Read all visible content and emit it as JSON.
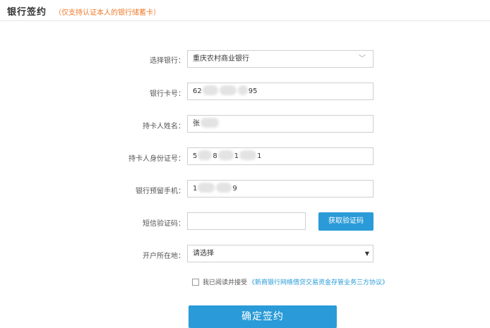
{
  "header": {
    "title": "银行签约",
    "note": "（仅支持认证本人的银行储蓄卡）"
  },
  "form": {
    "bank": {
      "label": "选择银行：",
      "value": "重庆农村商业银行"
    },
    "card_number": {
      "label": "银行卡号：",
      "prefix": "62",
      "suffix": "95"
    },
    "holder_name": {
      "label": "持卡人姓名：",
      "prefix": "张"
    },
    "id_number": {
      "label": "持卡人身份证号：",
      "prefix": "5",
      "middle_a": "8",
      "middle_b": "1",
      "suffix": "1"
    },
    "phone": {
      "label": "银行预留手机：",
      "prefix": "1",
      "suffix": "9"
    },
    "sms_code": {
      "label": "短信验证码：",
      "value": ""
    },
    "get_code_button": "获取验证码",
    "region": {
      "label": "开户所在地：",
      "value": "请选择"
    },
    "agreement": {
      "text": "我已阅读并接受",
      "link": "《新商银行网络借贷交易资金存管业务三方协议》"
    },
    "confirm_button": "确定签约"
  },
  "icons": {
    "bank_dropdown": "chevron-down-icon",
    "region_dropdown": "caret-down-icon"
  },
  "colors": {
    "accent": "#2a9bd8",
    "note": "#f07a2b"
  }
}
